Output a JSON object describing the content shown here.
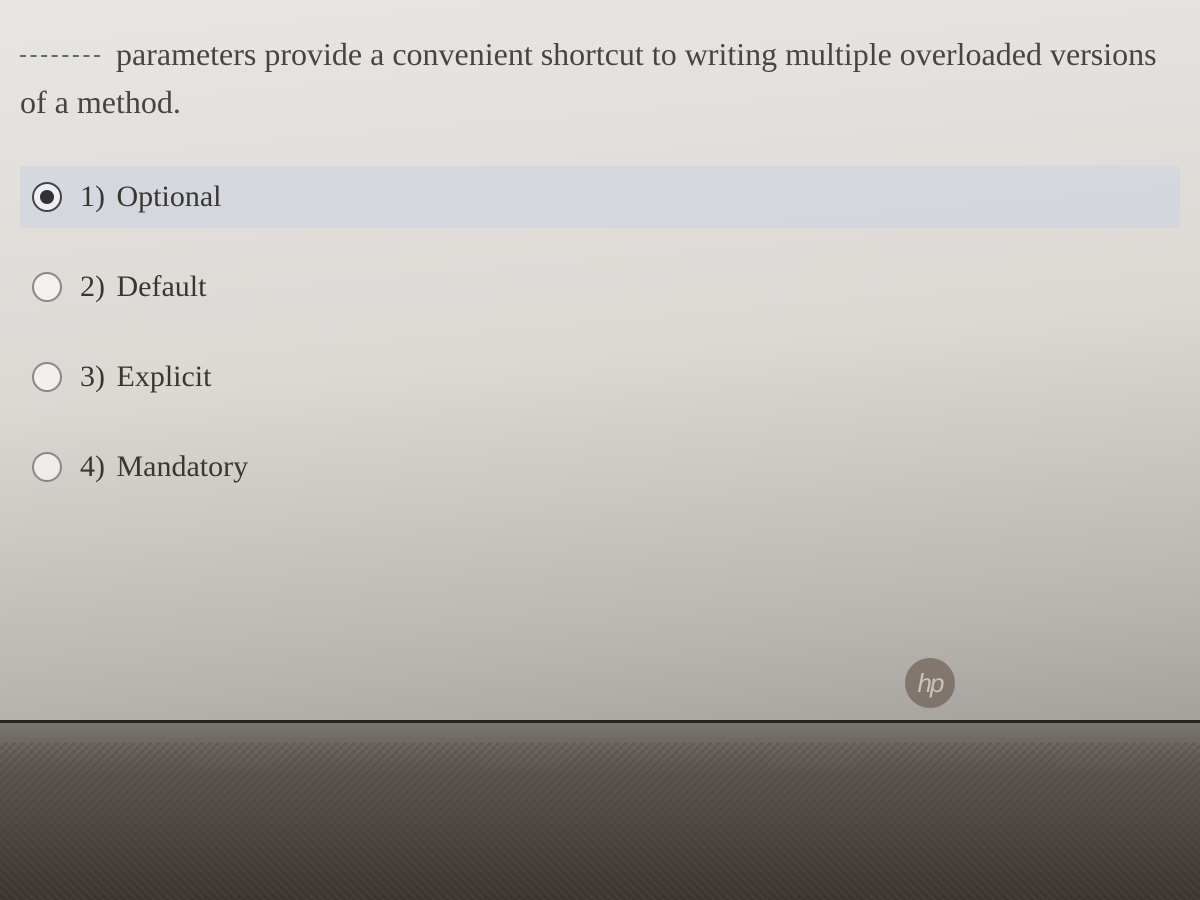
{
  "question": {
    "blank_prefix": "_____",
    "text_after_blank": "parameters provide a convenient shortcut to writing multiple overloaded versions of a method."
  },
  "options": [
    {
      "number": "1)",
      "label": "Optional",
      "selected": true
    },
    {
      "number": "2)",
      "label": "Default",
      "selected": false
    },
    {
      "number": "3)",
      "label": "Explicit",
      "selected": false
    },
    {
      "number": "4)",
      "label": "Mandatory",
      "selected": false
    }
  ],
  "logo": "hp"
}
